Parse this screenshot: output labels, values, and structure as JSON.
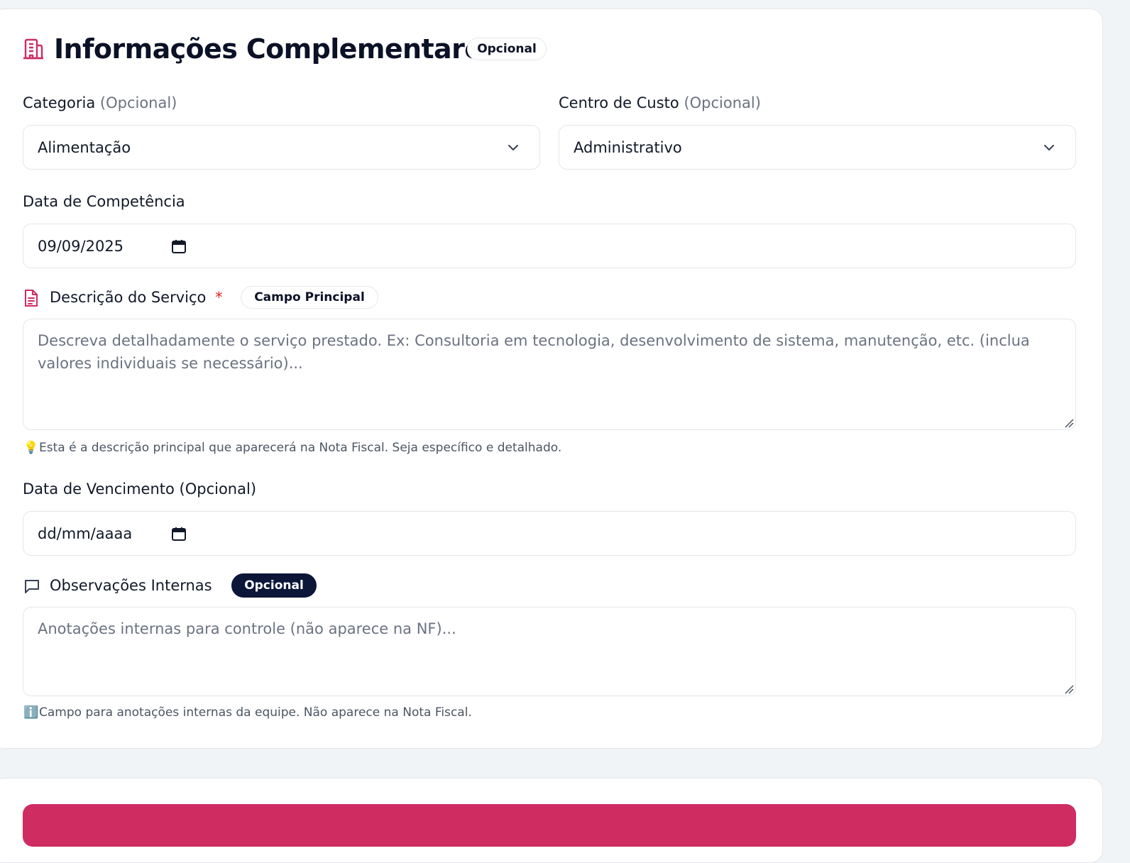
{
  "section": {
    "title": "Informações Complementares",
    "badge": "Opcional"
  },
  "categoria": {
    "label": "Categoria",
    "optional": "(Opcional)",
    "value": "Alimentação"
  },
  "centro_custo": {
    "label": "Centro de Custo",
    "optional": "(Opcional)",
    "value": "Administrativo"
  },
  "data_competencia": {
    "label": "Data de Competência",
    "value": "09/09/2025"
  },
  "descricao": {
    "label": "Descrição do Serviço",
    "required_mark": "*",
    "badge": "Campo Principal",
    "placeholder": "Descreva detalhadamente o serviço prestado. Ex: Consultoria em tecnologia, desenvolvimento de sistema, manutenção, etc. (inclua valores individuais se necessário)...",
    "hint_icon": "💡",
    "hint": "Esta é a descrição principal que aparecerá na Nota Fiscal. Seja específico e detalhado."
  },
  "data_vencimento": {
    "label": "Data de Vencimento (Opcional)",
    "value": "dd/mm/aaaa"
  },
  "observacoes": {
    "label": "Observações Internas",
    "badge": "Opcional",
    "placeholder": "Anotações internas para controle (não aparece na NF)...",
    "hint_icon": "ℹ️",
    "hint": "Campo para anotações internas da equipe. Não aparece na Nota Fiscal."
  },
  "colors": {
    "accent": "#cf2c62",
    "dark_badge": "#0b1638",
    "required": "#dc2626"
  }
}
